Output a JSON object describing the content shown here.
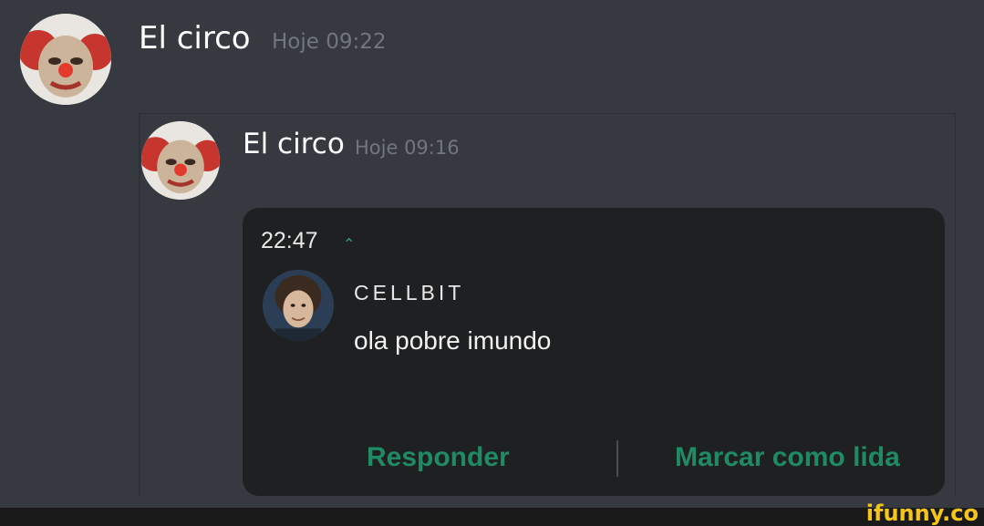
{
  "message_main": {
    "author": "El circo",
    "timestamp": "Hoje 09:22"
  },
  "message_quoted": {
    "author": "El circo",
    "timestamp": "Hoje 09:16"
  },
  "notification": {
    "time": "22:47",
    "sender": "CELLBIT",
    "text": "ola pobre imundo",
    "reply_label": "Responder",
    "mark_read_label": "Marcar como lida"
  },
  "watermark": "ifunny.co"
}
